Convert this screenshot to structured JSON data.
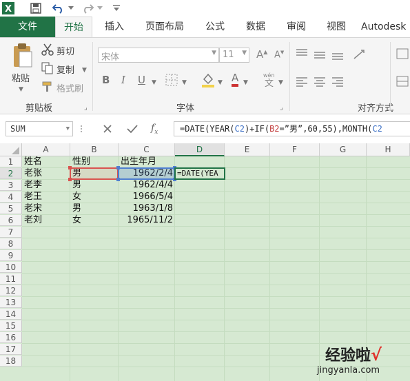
{
  "app": {
    "icon_letter": "X"
  },
  "tabs": [
    {
      "label": "文件"
    },
    {
      "label": "开始"
    },
    {
      "label": "插入"
    },
    {
      "label": "页面布局"
    },
    {
      "label": "公式"
    },
    {
      "label": "数据"
    },
    {
      "label": "审阅"
    },
    {
      "label": "视图"
    },
    {
      "label": "Autodesk"
    }
  ],
  "ribbon": {
    "clipboard": {
      "paste": "粘贴",
      "cut": "剪切",
      "copy": "复制",
      "format_painter": "格式刷",
      "group_label": "剪贴板"
    },
    "font": {
      "font_name": "宋体",
      "font_size": "11",
      "group_label": "字体",
      "bold": "B",
      "italic": "I",
      "underline": "U",
      "grow": "A",
      "shrink": "A",
      "font_color": "A"
    },
    "alignment": {
      "group_label": "对齐方式"
    }
  },
  "formula_bar": {
    "name_box": "SUM",
    "formula": {
      "p1": "=DATE(YEAR(",
      "r1": "C2",
      "p2": ")+IF(",
      "r2": "B2",
      "p3": "=”男”,60,55),MONTH(",
      "r3": "C2"
    }
  },
  "sheet": {
    "columns": [
      "A",
      "B",
      "C",
      "D",
      "E",
      "F",
      "G",
      "H"
    ],
    "rows": [
      "1",
      "2",
      "3",
      "4",
      "5",
      "6",
      "7",
      "8",
      "9",
      "10",
      "11",
      "12",
      "13",
      "14",
      "15",
      "16",
      "17",
      "18"
    ],
    "header": {
      "name": "姓名",
      "gender": "性别",
      "birth": "出生年月"
    },
    "data": [
      {
        "name": "老张",
        "gender": "男",
        "birth": "1962/2/4"
      },
      {
        "name": "老李",
        "gender": "男",
        "birth": "1962/4/4"
      },
      {
        "name": "老王",
        "gender": "女",
        "birth": "1966/5/4"
      },
      {
        "name": "老宋",
        "gender": "男",
        "birth": "1963/1/8"
      },
      {
        "name": "老刘",
        "gender": "女",
        "birth": "1965/11/2"
      }
    ],
    "editing_cell": "=DATE(YEA"
  },
  "watermark": {
    "text": "经验啦",
    "check": "√",
    "url": "jingyanla.com"
  }
}
